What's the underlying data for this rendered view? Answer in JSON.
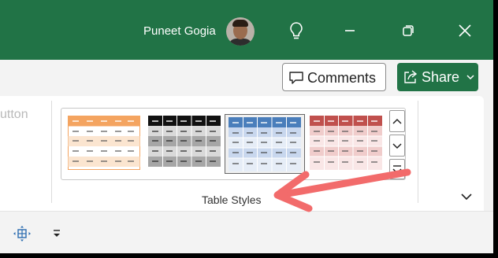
{
  "titlebar": {
    "user_name": "Puneet Gogia",
    "icons": [
      "avatar",
      "lightbulb-icon",
      "minimize-icon",
      "restore-icon",
      "close-icon"
    ]
  },
  "commandbar": {
    "comments_label": "Comments",
    "share_label": "Share"
  },
  "ribbon": {
    "faded_text": "utton",
    "group_label": "Table Styles",
    "styles": [
      {
        "name": "orange",
        "header": "#f4a460",
        "stripe": "#fbe5d0",
        "line": "#555"
      },
      {
        "name": "black",
        "header": "#111111",
        "stripe": "#a6a6a6",
        "line": "#222"
      },
      {
        "name": "blue",
        "header": "#4a7ebb",
        "stripe": "#c8d7ee",
        "line": "#444"
      },
      {
        "name": "red",
        "header": "#c0504d",
        "stripe": "#f0cccb",
        "line": "#555"
      }
    ],
    "selected_style": "blue"
  },
  "qat": {
    "icons": [
      "move-handle-icon",
      "customize-qat-icon"
    ]
  },
  "colors": {
    "brand": "#217346",
    "annotation_arrow": "#f26b6b"
  }
}
